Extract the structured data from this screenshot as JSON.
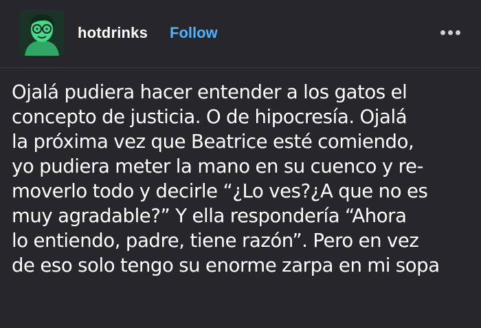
{
  "post": {
    "username": "hotdrinks",
    "follow_label": "Follow",
    "avatar_icon": "cartoon-avatar-green-glasses",
    "more_icon": "ellipsis-icon",
    "body": "Ojalá pudiera hacer entender a los gatos el\nconcepto de justicia. O de hipocresía. Ojalá\nla próxima vez que Beatrice esté comiendo,\nyo pudiera meter la mano en su cuenco y re-\nmoverlo todo y decirle “¿Lo ves?¿A que no es\nmuy agradable?” Y ella respondería “Ahora\nlo entiendo, padre, tiene razón”. Pero en vez\nde eso solo tengo su enorme zarpa en mi sopa"
  },
  "colors": {
    "background": "#26262b",
    "text": "#ffffff",
    "follow": "#4db3ff",
    "avatar_green": "#3ccf86"
  }
}
